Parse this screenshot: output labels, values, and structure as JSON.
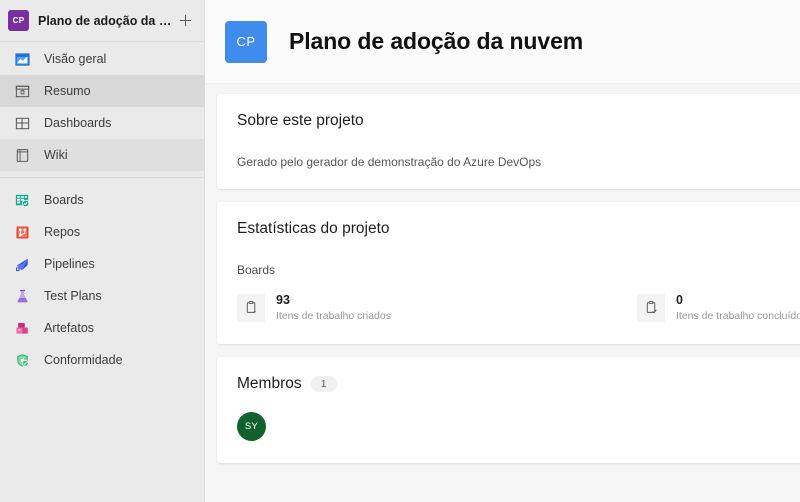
{
  "sidebar": {
    "project": {
      "initials": "CP",
      "name": "Plano de adoção da nuvem",
      "logo_color": "#7a2fa0",
      "add_label": "+"
    },
    "items": [
      {
        "label": "Visão geral",
        "icon": "overview-icon",
        "state": "normal"
      },
      {
        "label": "Resumo",
        "icon": "summary-icon",
        "state": "selected"
      },
      {
        "label": "Dashboards",
        "icon": "dashboards-icon",
        "state": "normal"
      },
      {
        "label": "Wiki",
        "icon": "wiki-icon",
        "state": "hovered"
      },
      {
        "label": "Boards",
        "icon": "boards-icon",
        "state": "normal"
      },
      {
        "label": "Repos",
        "icon": "repos-icon",
        "state": "normal"
      },
      {
        "label": "Pipelines",
        "icon": "pipelines-icon",
        "state": "normal"
      },
      {
        "label": "Test Plans",
        "icon": "test-plans-icon",
        "state": "normal"
      },
      {
        "label": "Artefatos",
        "icon": "artifacts-icon",
        "state": "normal"
      },
      {
        "label": "Conformidade",
        "icon": "compliance-icon",
        "state": "normal"
      }
    ]
  },
  "header": {
    "initials": "CP",
    "title": "Plano de adoção da nuvem",
    "logo_color": "#3f8cec"
  },
  "about_card": {
    "title": "Sobre este projeto",
    "description": "Gerado pelo gerador de demonstração do Azure DevOps"
  },
  "stats_card": {
    "title": "Estatísticas do projeto",
    "group_label": "Boards",
    "stats": [
      {
        "value": "93",
        "label": "Itens de trabalho criados",
        "icon": "clipboard-icon"
      },
      {
        "value": "0",
        "label": "Itens de trabalho concluídos",
        "icon": "clipboard-check-icon"
      }
    ]
  },
  "members_card": {
    "title": "Membros",
    "count": "1",
    "members": [
      {
        "initials": "SY",
        "color": "#10622c"
      }
    ]
  }
}
